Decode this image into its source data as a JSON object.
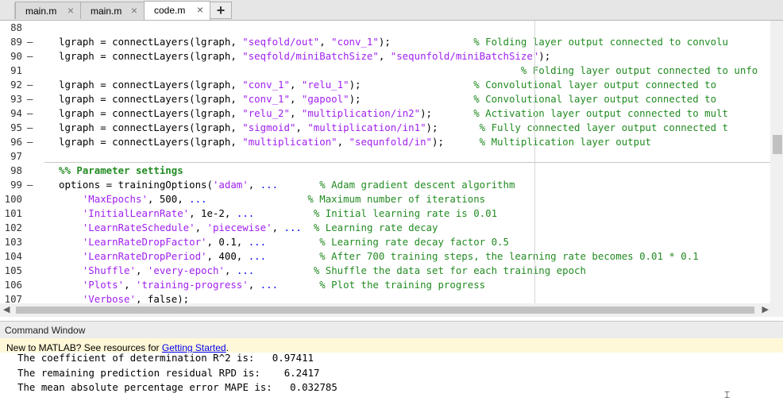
{
  "tabs": [
    {
      "label": "main.m",
      "active": false
    },
    {
      "label": "main.m",
      "active": false
    },
    {
      "label": "code.m",
      "active": true
    }
  ],
  "tab_close_glyph": "×",
  "add_tab_glyph": "+",
  "editor": {
    "lines": [
      {
        "num": "88",
        "bp": "",
        "segs": []
      },
      {
        "num": "89",
        "bp": "—",
        "segs": [
          [
            "kw",
            "lgraph = connectLayers(lgraph, "
          ],
          [
            "str",
            "\"seqfold/out\""
          ],
          [
            "kw",
            ", "
          ],
          [
            "str",
            "\"conv_1\""
          ],
          [
            "kw",
            ");              "
          ],
          [
            "cmt",
            "% Folding layer output connected to convolu"
          ]
        ]
      },
      {
        "num": "90",
        "bp": "—",
        "segs": [
          [
            "kw",
            "lgraph = connectLayers(lgraph, "
          ],
          [
            "str",
            "\"seqfold/miniBatchSize\""
          ],
          [
            "kw",
            ", "
          ],
          [
            "str",
            "\"sequnfold/miniBatchSize\""
          ],
          [
            "kw",
            ");"
          ]
        ]
      },
      {
        "num": "91",
        "bp": "",
        "segs": [
          [
            "kw",
            "                                                                              "
          ],
          [
            "cmt",
            "% Folding layer output connected to unfo"
          ]
        ]
      },
      {
        "num": "92",
        "bp": "—",
        "segs": [
          [
            "kw",
            "lgraph = connectLayers(lgraph, "
          ],
          [
            "str",
            "\"conv_1\""
          ],
          [
            "kw",
            ", "
          ],
          [
            "str",
            "\"relu_1\""
          ],
          [
            "kw",
            ");                   "
          ],
          [
            "cmt",
            "% Convolutional layer output connected to"
          ]
        ]
      },
      {
        "num": "93",
        "bp": "—",
        "segs": [
          [
            "kw",
            "lgraph = connectLayers(lgraph, "
          ],
          [
            "str",
            "\"conv_1\""
          ],
          [
            "kw",
            ", "
          ],
          [
            "str",
            "\"gapool\""
          ],
          [
            "kw",
            ");                   "
          ],
          [
            "cmt",
            "% Convolutional layer output connected to"
          ]
        ]
      },
      {
        "num": "94",
        "bp": "—",
        "segs": [
          [
            "kw",
            "lgraph = connectLayers(lgraph, "
          ],
          [
            "str",
            "\"relu_2\""
          ],
          [
            "kw",
            ", "
          ],
          [
            "str",
            "\"multiplication/in2\""
          ],
          [
            "kw",
            ");       "
          ],
          [
            "cmt",
            "% Activation layer output connected to mult"
          ]
        ]
      },
      {
        "num": "95",
        "bp": "—",
        "segs": [
          [
            "kw",
            "lgraph = connectLayers(lgraph, "
          ],
          [
            "str",
            "\"sigmoid\""
          ],
          [
            "kw",
            ", "
          ],
          [
            "str",
            "\"multiplication/in1\""
          ],
          [
            "kw",
            ");       "
          ],
          [
            "cmt",
            "% Fully connected layer output connected t"
          ]
        ]
      },
      {
        "num": "96",
        "bp": "—",
        "segs": [
          [
            "kw",
            "lgraph = connectLayers(lgraph, "
          ],
          [
            "str",
            "\"multiplication\""
          ],
          [
            "kw",
            ", "
          ],
          [
            "str",
            "\"sequnfold/in\""
          ],
          [
            "kw",
            ");      "
          ],
          [
            "cmt",
            "% Multiplication layer output"
          ]
        ]
      },
      {
        "num": "97",
        "bp": "",
        "segs": []
      },
      {
        "num": "98",
        "bp": "",
        "segs": [
          [
            "sec",
            "%% Parameter settings"
          ]
        ]
      },
      {
        "num": "99",
        "bp": "—",
        "segs": [
          [
            "kw",
            "options = trainingOptions("
          ],
          [
            "str",
            "'adam'"
          ],
          [
            "kw",
            ", "
          ],
          [
            "cont",
            "..."
          ],
          [
            "kw",
            "       "
          ],
          [
            "cmt",
            "% Adam gradient descent algorithm"
          ]
        ]
      },
      {
        "num": "100",
        "bp": "",
        "segs": [
          [
            "kw",
            "    "
          ],
          [
            "str",
            "'MaxEpochs'"
          ],
          [
            "kw",
            ", 500, "
          ],
          [
            "cont",
            "..."
          ],
          [
            "kw",
            "                 "
          ],
          [
            "cmt",
            "% Maximum number of iterations"
          ]
        ]
      },
      {
        "num": "101",
        "bp": "",
        "segs": [
          [
            "kw",
            "    "
          ],
          [
            "str",
            "'InitialLearnRate'"
          ],
          [
            "kw",
            ", 1e-2, "
          ],
          [
            "cont",
            "..."
          ],
          [
            "kw",
            "          "
          ],
          [
            "cmt",
            "% Initial learning rate is 0.01"
          ]
        ]
      },
      {
        "num": "102",
        "bp": "",
        "segs": [
          [
            "kw",
            "    "
          ],
          [
            "str",
            "'LearnRateSchedule'"
          ],
          [
            "kw",
            ", "
          ],
          [
            "str",
            "'piecewise'"
          ],
          [
            "kw",
            ", "
          ],
          [
            "cont",
            "..."
          ],
          [
            "kw",
            "  "
          ],
          [
            "cmt",
            "% Learning rate decay"
          ]
        ]
      },
      {
        "num": "103",
        "bp": "",
        "segs": [
          [
            "kw",
            "    "
          ],
          [
            "str",
            "'LearnRateDropFactor'"
          ],
          [
            "kw",
            ", 0.1, "
          ],
          [
            "cont",
            "..."
          ],
          [
            "kw",
            "         "
          ],
          [
            "cmt",
            "% Learning rate decay factor 0.5"
          ]
        ]
      },
      {
        "num": "104",
        "bp": "",
        "segs": [
          [
            "kw",
            "    "
          ],
          [
            "str",
            "'LearnRateDropPeriod'"
          ],
          [
            "kw",
            ", 400, "
          ],
          [
            "cont",
            "..."
          ],
          [
            "kw",
            "         "
          ],
          [
            "cmt",
            "% After 700 training steps, the learning rate becomes 0.01 * 0.1"
          ]
        ]
      },
      {
        "num": "105",
        "bp": "",
        "segs": [
          [
            "kw",
            "    "
          ],
          [
            "str",
            "'Shuffle'"
          ],
          [
            "kw",
            ", "
          ],
          [
            "str",
            "'every-epoch'"
          ],
          [
            "kw",
            ", "
          ],
          [
            "cont",
            "..."
          ],
          [
            "kw",
            "          "
          ],
          [
            "cmt",
            "% Shuffle the data set for each training epoch"
          ]
        ]
      },
      {
        "num": "106",
        "bp": "",
        "segs": [
          [
            "kw",
            "    "
          ],
          [
            "str",
            "'Plots'"
          ],
          [
            "kw",
            ", "
          ],
          [
            "str",
            "'training-progress'"
          ],
          [
            "kw",
            ", "
          ],
          [
            "cont",
            "..."
          ],
          [
            "kw",
            "       "
          ],
          [
            "cmt",
            "% Plot the training progress"
          ]
        ]
      },
      {
        "num": "107",
        "bp": "",
        "segs": [
          [
            "kw",
            "    "
          ],
          [
            "str",
            "'Verbose'"
          ],
          [
            "kw",
            ", false);"
          ]
        ]
      }
    ]
  },
  "command_window": {
    "title": "Command Window",
    "banner_prefix": "New to MATLAB? See resources for ",
    "banner_link": "Getting Started",
    "banner_suffix": ".",
    "output": [
      "The coefficient of determination R^2 is:   0.97411",
      "The remaining prediction residual RPD is:    6.2417",
      "The mean absolute percentage error MAPE is:   0.032785"
    ]
  }
}
